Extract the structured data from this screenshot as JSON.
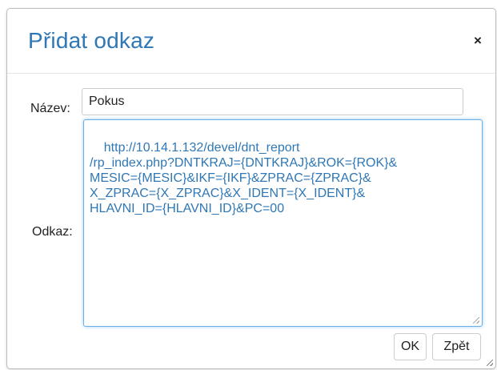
{
  "dialog": {
    "title": "Přidat odkaz",
    "close_icon": "×",
    "name_label": "Název:",
    "name_value": "Pokus",
    "link_label": "Odkaz:",
    "link_value": "http://10.14.1.132/devel/dnt_report\n/rp_index.php?DNTKRAJ={DNTKRAJ}&ROK={ROK}&\nMESIC={MESIC}&IKF={IKF}&ZPRAC={ZPRAC}&\nX_ZPRAC={X_ZPRAC}&X_IDENT={X_IDENT}&\nHLAVNI_ID={HLAVNI_ID}&PC=00",
    "ok_label": "OK",
    "back_label": "Zpět"
  },
  "colors": {
    "title": "#2f77b5",
    "link_text": "#2f77b5",
    "focus_border": "#66afe9"
  }
}
